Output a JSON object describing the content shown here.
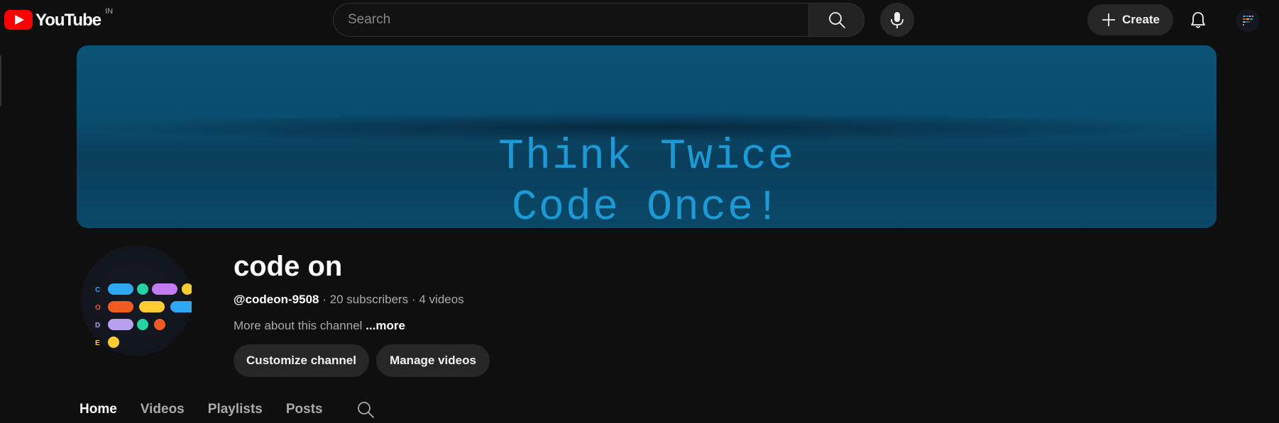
{
  "header": {
    "logo_text": "YouTube",
    "country_code": "IN",
    "search_placeholder": "Search",
    "create_label": "Create"
  },
  "banner": {
    "line1": "Think Twice",
    "line2": "Code Once!"
  },
  "channel": {
    "name": "code on",
    "handle": "@codeon-9508",
    "subscribers": "20 subscribers",
    "videos": "4 videos",
    "separator": "·",
    "about": "More about this channel",
    "about_more": "...more",
    "customize_label": "Customize channel",
    "manage_label": "Manage videos",
    "avatar_letters": [
      "C",
      "O",
      "D",
      "E"
    ]
  },
  "tabs": [
    {
      "label": "Home",
      "active": true
    },
    {
      "label": "Videos",
      "active": false
    },
    {
      "label": "Playlists",
      "active": false
    },
    {
      "label": "Posts",
      "active": false
    }
  ],
  "colors": {
    "background": "#0f0f0f",
    "youtube_red": "#ff0000",
    "banner_text": "#1c9ad6",
    "logo_blue": "#2ea8f0",
    "logo_green": "#24d3a0",
    "logo_purple": "#c07cf0",
    "logo_yellow": "#ffcc33",
    "logo_orange": "#f25c22",
    "logo_lavender": "#b8a0f0"
  }
}
